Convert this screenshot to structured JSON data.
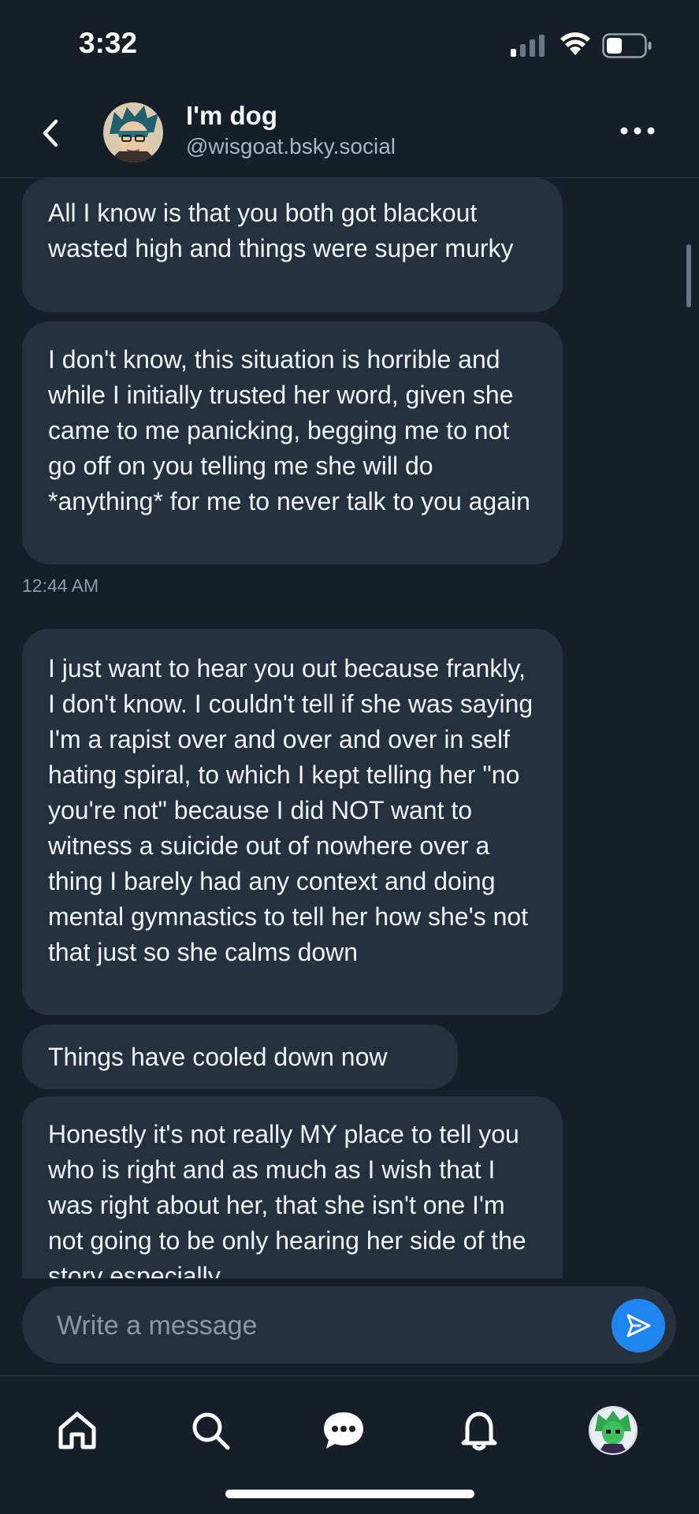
{
  "status_bar": {
    "time": "3:32",
    "icons": [
      "cellular-signal-icon",
      "wifi-icon",
      "battery-icon"
    ]
  },
  "header": {
    "name": "I'm dog",
    "handle": "@wisgoat.bsky.social",
    "icons": [
      "chevron-left-icon",
      "more-horizontal-icon"
    ]
  },
  "messages": [
    {
      "text": "All I know is that you both got blackout wasted high and things were super murky"
    },
    {
      "text": "I don't know, this situation is horrible and while I initially trusted her word, given she came to me panicking, begging me to not go off on you telling me she will do *anything* for me to never talk to you again"
    },
    {
      "text": "I just want to hear you out because frankly, I don't know. I couldn't tell if she was saying I'm a rapist over and over and over in self hating spiral, to which I kept telling her \"no you're not\" because I did NOT want to witness a suicide out of nowhere over a thing I barely had any context and doing mental gymnastics to tell her how she's not that just so she calms down"
    },
    {
      "text": "Things have cooled down now"
    },
    {
      "text": "Honestly it's not really MY place to tell you who is right and as much as I wish that I was right about her, that she isn't one I'm not going to be only hearing her side of the story especially"
    }
  ],
  "timestamp": "12:44 AM",
  "composer": {
    "placeholder": "Write a message",
    "value": "",
    "send_icon": "send-icon"
  },
  "bottom_nav": {
    "items": [
      "home-icon",
      "search-icon",
      "messages-icon",
      "notifications-icon",
      "profile-avatar"
    ]
  },
  "colors": {
    "background": "#161e27",
    "bubble": "#26313f",
    "accent": "#1f86f0",
    "muted_text": "#a9b5c2"
  }
}
